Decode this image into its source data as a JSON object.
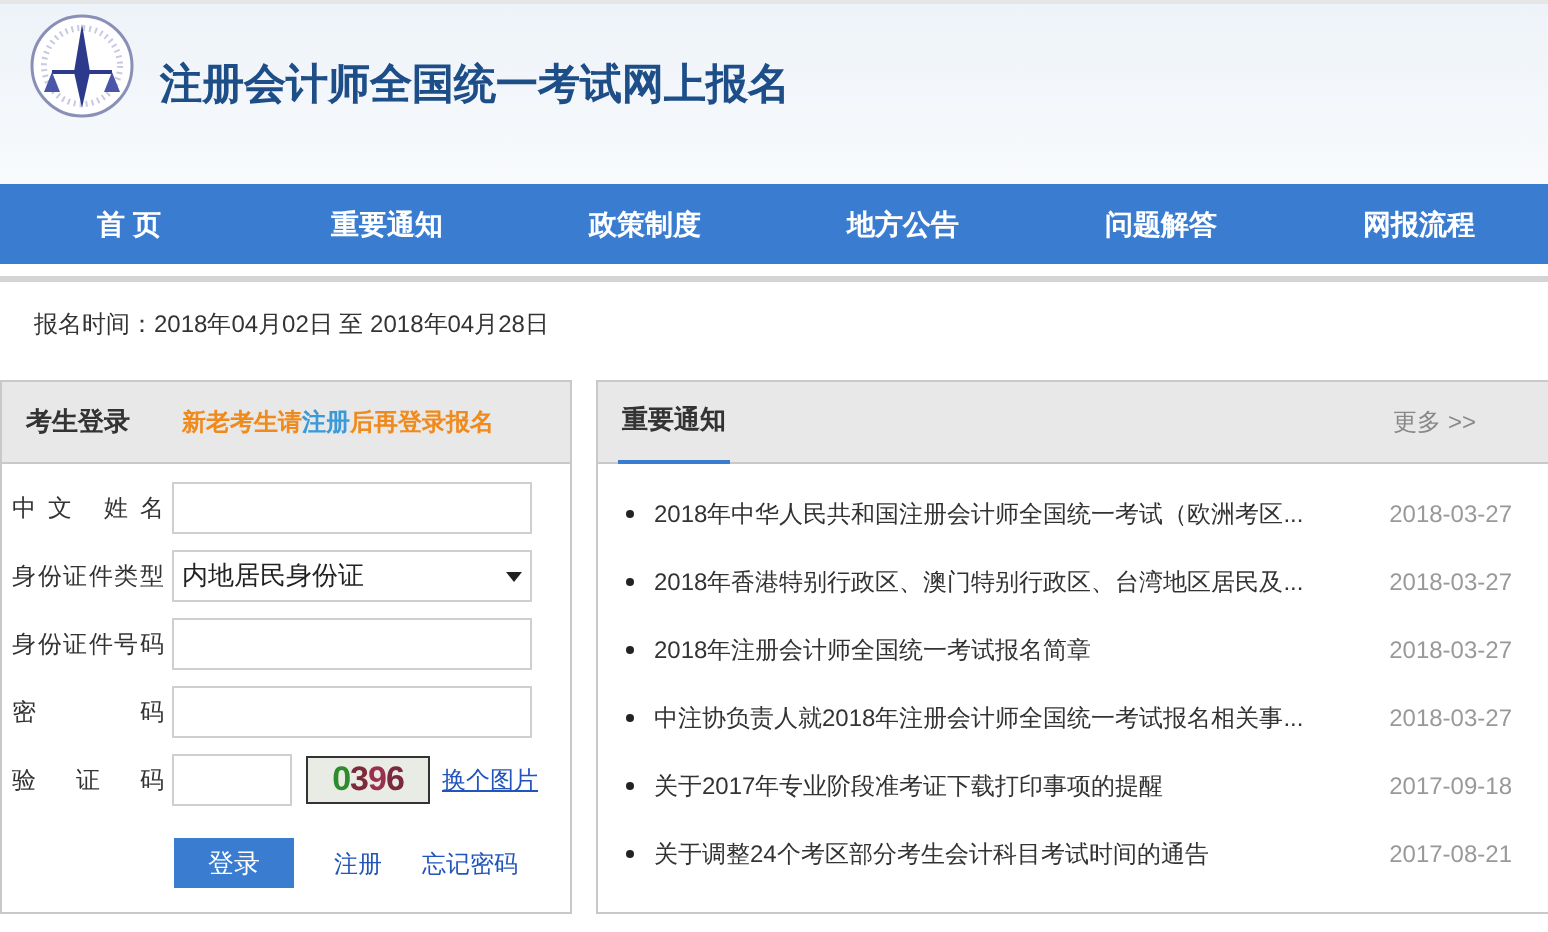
{
  "header": {
    "title": "注册会计师全国统一考试网上报名"
  },
  "nav": [
    {
      "label": "首 页"
    },
    {
      "label": "重要通知"
    },
    {
      "label": "政策制度"
    },
    {
      "label": "地方公告"
    },
    {
      "label": "问题解答"
    },
    {
      "label": "网报流程"
    }
  ],
  "period": "报名时间：2018年04月02日 至 2018年04月28日",
  "login": {
    "title": "考生登录",
    "hint_before": "新老考生请",
    "hint_link": "注册",
    "hint_after": "后再登录报名",
    "fields": [
      {
        "kind": "text",
        "label": "中文 姓名"
      },
      {
        "kind": "select",
        "label": "身份证件类型",
        "value": "内地居民身份证"
      },
      {
        "kind": "text",
        "label": "身份证件号码"
      },
      {
        "kind": "password",
        "label": "密 码"
      },
      {
        "kind": "captcha",
        "label": "验 证 码",
        "captcha": "0396",
        "refresh": "换个图片"
      }
    ],
    "submit": "登录",
    "register": "注册",
    "forgot": "忘记密码"
  },
  "notices": {
    "title": "重要通知",
    "more": "更多 >>",
    "items": [
      {
        "text": "2018年中华人民共和国注册会计师全国统一考试（欧洲考区...",
        "date": "2018-03-27"
      },
      {
        "text": "2018年香港特别行政区、澳门特别行政区、台湾地区居民及...",
        "date": "2018-03-27"
      },
      {
        "text": "2018年注册会计师全国统一考试报名简章",
        "date": "2018-03-27"
      },
      {
        "text": "中注协负责人就2018年注册会计师全国统一考试报名相关事...",
        "date": "2018-03-27"
      },
      {
        "text": "关于2017年专业阶段准考证下载打印事项的提醒",
        "date": "2017-09-18"
      },
      {
        "text": "关于调整24个考区部分考生会计科目考试时间的通告",
        "date": "2017-08-21"
      }
    ]
  }
}
